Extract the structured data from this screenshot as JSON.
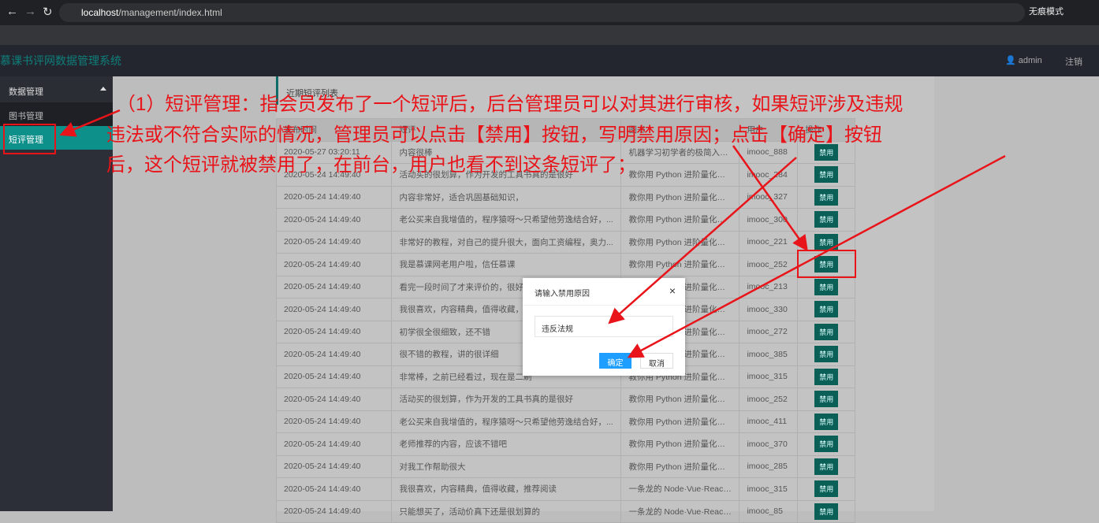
{
  "browser": {
    "url_host": "localhost",
    "url_path": "/management/index.html",
    "incognito": "无痕模式"
  },
  "app": {
    "title": "慕课书评网数据管理系统",
    "user": "admin",
    "logout": "注销"
  },
  "sidebar": {
    "group": "数据管理",
    "items": [
      {
        "label": "图书管理"
      },
      {
        "label": "短评管理"
      }
    ]
  },
  "panel": {
    "title": "近期短评列表"
  },
  "table": {
    "headers": [
      "发布时间",
      "短评",
      "图书",
      "用户",
      "操作"
    ],
    "ban_label": "禁用",
    "rows": [
      [
        "2020-05-27 03:20:11",
        "内容很棒",
        "机器学习初学者的极简入门课",
        "imooc_888"
      ],
      [
        "2020-05-24 14:49:40",
        "活动买的很划算，作为开发的工具书真的是很好",
        "教你用 Python 进阶量化交易",
        "imooc_284"
      ],
      [
        "2020-05-24 14:49:40",
        "内容非常好，适合巩固基础知识，",
        "教你用 Python 进阶量化交易",
        "imooc_327"
      ],
      [
        "2020-05-24 14:49:40",
        "老公买来自我增值的，程序猿呀～只希望他劳逸结合好，...",
        "教你用 Python 进阶量化交易",
        "imooc_300"
      ],
      [
        "2020-05-24 14:49:40",
        "非常好的教程，对自己的提升很大，面向工资编程，奥力...",
        "教你用 Python 进阶量化交易",
        "imooc_221"
      ],
      [
        "2020-05-24 14:49:40",
        "我是慕课网老用户啦，信任慕课",
        "教你用 Python 进阶量化交易",
        "imooc_252"
      ],
      [
        "2020-05-24 14:49:40",
        "看完一段时间了才来评价的，很好",
        "教你用 Python 进阶量化交易",
        "imooc_213"
      ],
      [
        "2020-05-24 14:49:40",
        "我很喜欢，内容精典，值得收藏，推荐阅读",
        "教你用 Python 进阶量化交易",
        "imooc_330"
      ],
      [
        "2020-05-24 14:49:40",
        "初学很全很细致，还不错",
        "教你用 Python 进阶量化交易",
        "imooc_272"
      ],
      [
        "2020-05-24 14:49:40",
        "很不错的教程，讲的很详细",
        "教你用 Python 进阶量化交易",
        "imooc_385"
      ],
      [
        "2020-05-24 14:49:40",
        "非常棒，之前已经看过，现在是二刷",
        "教你用 Python 进阶量化交易",
        "imooc_315"
      ],
      [
        "2020-05-24 14:49:40",
        "活动买的很划算，作为开发的工具书真的是很好",
        "教你用 Python 进阶量化交易",
        "imooc_252"
      ],
      [
        "2020-05-24 14:49:40",
        "老公买来自我增值的，程序猿呀～只希望他劳逸结合好，...",
        "教你用 Python 进阶量化交易",
        "imooc_411"
      ],
      [
        "2020-05-24 14:49:40",
        "老师推荐的内容，应该不错吧",
        "教你用 Python 进阶量化交易",
        "imooc_370"
      ],
      [
        "2020-05-24 14:49:40",
        "对我工作帮助很大",
        "教你用 Python 进阶量化交易",
        "imooc_285"
      ],
      [
        "2020-05-24 14:49:40",
        "我很喜欢，内容精典，值得收藏，推荐阅读",
        "一条龙的 Node·Vue·React 服...",
        "imooc_315"
      ],
      [
        "2020-05-24 14:49:40",
        "只能想买了，活动价真下还是很划算的",
        "一条龙的 Node·Vue·React 服...",
        "imooc_85"
      ]
    ]
  },
  "modal": {
    "title": "请输入禁用原因",
    "close": "×",
    "input_value": "违反法规",
    "ok": "确定",
    "cancel": "取消"
  },
  "annotation": {
    "lines": [
      "（1）短评管理：指会员发布了一个短评后，后台管理员可以对其进行审核，如果短评涉及违规",
      "违法或不符合实际的情况，管理员可以点击【禁用】按钮，写明禁用原因；点击【确定】按钮",
      "后，这个短评就被禁用了，在前台，用户也看不到这条短评了；"
    ],
    "color": "#e8141a"
  }
}
